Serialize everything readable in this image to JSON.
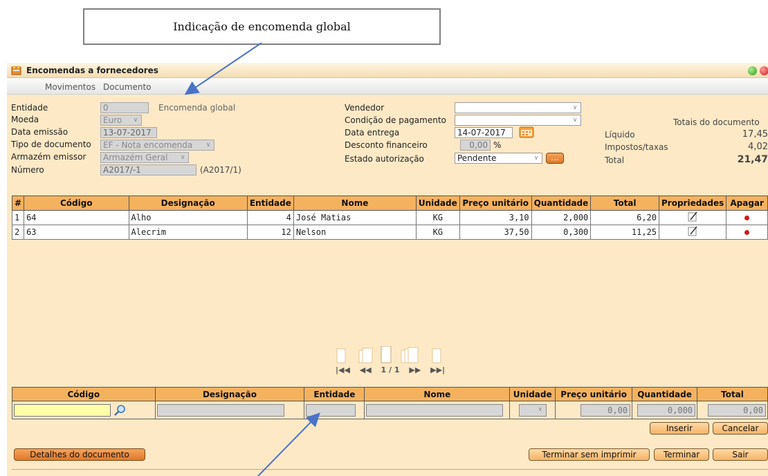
{
  "callout": {
    "text": "Indicação de encomenda global"
  },
  "window": {
    "title": "Encomendas a fornecedores",
    "menu": [
      "Movimentos",
      "Documento"
    ]
  },
  "header_form": {
    "entidade": {
      "label": "Entidade",
      "value": "0",
      "note": "Encomenda global"
    },
    "moeda": {
      "label": "Moeda",
      "value": "Euro"
    },
    "data_emissao": {
      "label": "Data emissão",
      "value": "13-07-2017"
    },
    "tipo_documento": {
      "label": "Tipo de documento",
      "value": "EF - Nota encomenda"
    },
    "armazem_emissor": {
      "label": "Armazém emissor",
      "value": "Armazém Geral"
    },
    "numero": {
      "label": "Número",
      "value": "A2017/-1",
      "suffix": "(A2017/1)"
    },
    "vendedor": {
      "label": "Vendedor",
      "value": ""
    },
    "condicao_pagamento": {
      "label": "Condição de pagamento",
      "value": ""
    },
    "data_entrega": {
      "label": "Data entrega",
      "value": "14-07-2017"
    },
    "desconto_financeiro": {
      "label": "Desconto financeiro",
      "value": "0,00",
      "unit": "%"
    },
    "estado_autorizacao": {
      "label": "Estado autorização",
      "value": "Pendente"
    }
  },
  "totals": {
    "heading": "Totais do documento",
    "rows": [
      {
        "label": "Líquido",
        "value": "17,45"
      },
      {
        "label": "Impostos/taxas",
        "value": "4,02"
      },
      {
        "label": "Total",
        "value": "21,47"
      }
    ]
  },
  "lines_table": {
    "columns": [
      "#",
      "Código",
      "Designação",
      "Entidade",
      "Nome",
      "Unidade",
      "Preço unitário",
      "Quantidade",
      "Total",
      "Propriedades",
      "Apagar"
    ],
    "rows": [
      {
        "n": "1",
        "codigo": "64",
        "designacao": "Alho",
        "entidade": "4",
        "nome": "José Matias",
        "unidade": "KG",
        "preco": "3,10",
        "quantidade": "2,000",
        "total": "6,20"
      },
      {
        "n": "2",
        "codigo": "63",
        "designacao": "Alecrim",
        "entidade": "12",
        "nome": "Nelson",
        "unidade": "KG",
        "preco": "37,50",
        "quantidade": "0,300",
        "total": "11,25"
      }
    ]
  },
  "pager": {
    "page": "1 / 1",
    "first": "|◀◀",
    "prev": "◀◀",
    "next": "▶▶",
    "last": "▶▶|"
  },
  "entry_table": {
    "columns": [
      "Código",
      "Designação",
      "Entidade",
      "Nome",
      "Unidade",
      "Preço unitário",
      "Quantidade",
      "Total"
    ],
    "values": {
      "preco": "0,00",
      "quantidade": "0,000",
      "total": "0,00"
    }
  },
  "buttons": {
    "inserir": "Inserir",
    "cancelar": "Cancelar",
    "detalhes": "Detalhes do documento",
    "terminar_sem_imprimir": "Terminar sem imprimir",
    "terminar": "Terminar",
    "sair": "Sair"
  },
  "colors": {
    "window_bg": "#fde9c6",
    "header_orange": "#f4b25f",
    "arrow_blue": "#4a73c8"
  }
}
